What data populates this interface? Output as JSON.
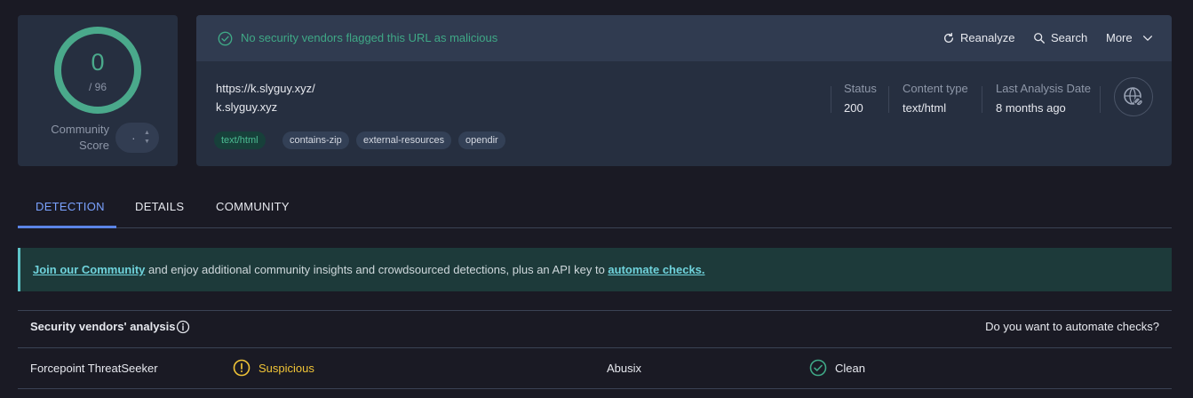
{
  "score": {
    "value": "0",
    "total": "/ 96",
    "community_label_line1": "Community",
    "community_label_line2": "Score",
    "community_value": "·"
  },
  "banner": {
    "status_text": "No security vendors flagged this URL as malicious",
    "actions": {
      "reanalyze": "Reanalyze",
      "search": "Search",
      "more": "More"
    }
  },
  "url_info": {
    "url": "https://k.slyguy.xyz/",
    "host": "k.slyguy.xyz",
    "tags": [
      "text/html",
      "contains-zip",
      "external-resources",
      "opendir"
    ]
  },
  "meta": {
    "status_label": "Status",
    "status_value": "200",
    "content_type_label": "Content type",
    "content_type_value": "text/html",
    "last_analysis_label": "Last Analysis Date",
    "last_analysis_value": "8 months ago"
  },
  "tabs": [
    "DETECTION",
    "DETAILS",
    "COMMUNITY"
  ],
  "join": {
    "link1": "Join our Community",
    "middle": " and enjoy additional community insights and crowdsourced detections, plus an API key to ",
    "link2": "automate checks."
  },
  "vendors": {
    "title": "Security vendors' analysis",
    "automate_question": "Do you want to automate checks?",
    "rows": [
      {
        "left_vendor": "Forcepoint ThreatSeeker",
        "left_verdict": "Suspicious",
        "right_vendor": "Abusix",
        "right_verdict": "Clean"
      }
    ]
  },
  "colors": {
    "background": "#1a1a24",
    "panel": "#262f40",
    "clean_green": "#3fa886",
    "suspicious_yellow": "#f0c437",
    "tab_active": "#7aa2ff",
    "join_link": "#6fd3dc"
  }
}
